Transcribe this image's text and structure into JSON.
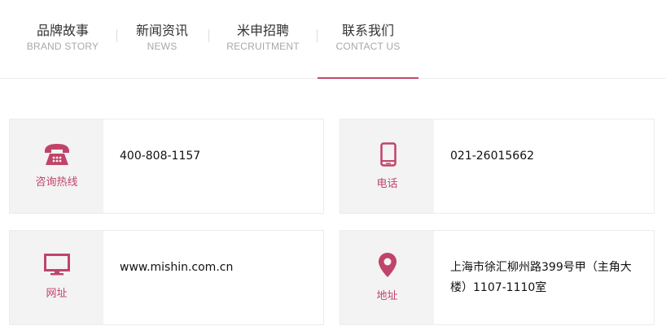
{
  "accent_color": "#c8476a",
  "nav": {
    "items": [
      {
        "cn": "品牌故事",
        "en": "BRAND STORY",
        "active": false
      },
      {
        "cn": "新闻资讯",
        "en": "NEWS",
        "active": false
      },
      {
        "cn": "米申招聘",
        "en": "RECRUITMENT",
        "active": false
      },
      {
        "cn": "联系我们",
        "en": "CONTACT US",
        "active": true
      }
    ]
  },
  "contacts": [
    {
      "icon": "telephone-icon",
      "label": "咨询热线",
      "value": "400-808-1157"
    },
    {
      "icon": "mobile-phone-icon",
      "label": "电话",
      "value": "021-26015662"
    },
    {
      "icon": "monitor-icon",
      "label": "网址",
      "value": "www.mishin.com.cn"
    },
    {
      "icon": "location-pin-icon",
      "label": "地址",
      "value": "上海市徐汇柳州路399号甲（主角大楼）1107-1110室"
    }
  ]
}
